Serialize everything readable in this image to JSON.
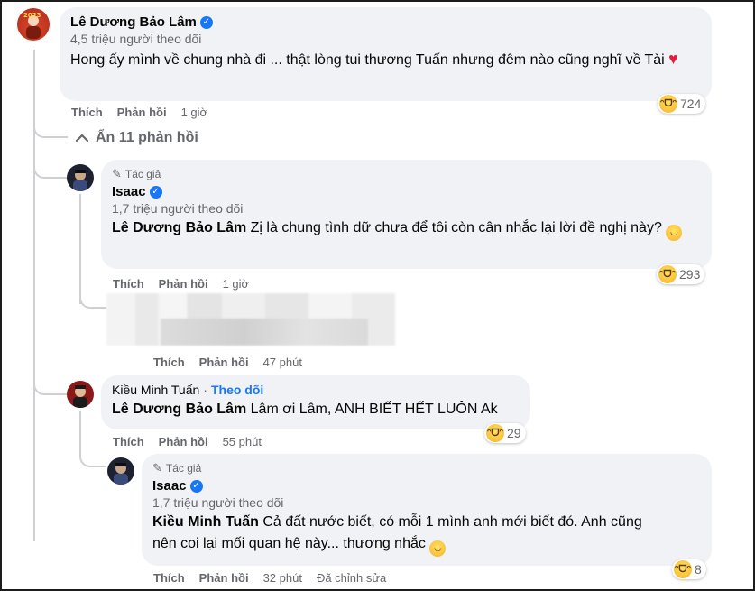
{
  "comment1": {
    "author": "Lê Dương Bảo Lâm",
    "followers": "4,5 triệu người theo dõi",
    "text": "Hong ấy mình về chung nhà đi ... thật lòng tui thương Tuấn nhưng đêm nào cũng nghĩ về Tài",
    "like_label": "Thích",
    "reply_label": "Phản hồi",
    "time": "1 giờ",
    "reaction_count": "724"
  },
  "toggle": {
    "label": "Ẩn 11 phản hồi"
  },
  "reply1": {
    "author_badge": "Tác giả",
    "author": "Isaac",
    "followers": "1,7 triệu người theo dõi",
    "mention": "Lê Dương Bảo Lâm",
    "text": "Zị là chung tình dữ chưa để tôi còn cân nhắc lại lời đề nghị này?",
    "like_label": "Thích",
    "reply_label": "Phản hồi",
    "time": "1 giờ",
    "reaction_count": "293"
  },
  "reply_blurred": {
    "like_label": "Thích",
    "reply_label": "Phản hồi",
    "time": "47 phút"
  },
  "reply2": {
    "author": "Kiều Minh Tuấn",
    "separator": "·",
    "follow_label": "Theo dõi",
    "mention": "Lê Dương Bảo Lâm",
    "text": "Lâm ơi Lâm, ANH BIẾT HẾT LUÔN Ak",
    "like_label": "Thích",
    "reply_label": "Phản hồi",
    "time": "55 phút",
    "reaction_count": "29"
  },
  "reply3": {
    "author_badge": "Tác giả",
    "author": "Isaac",
    "followers": "1,7 triệu người theo dõi",
    "mention": "Kiều Minh Tuấn",
    "text_line1": "Cả đất nước biết, có mỗi 1 mình anh mới biết đó. Anh cũng",
    "text_line2": "nên coi lại mối quan hệ này... thương nhắc",
    "like_label": "Thích",
    "reply_label": "Phản hồi",
    "time": "32 phút",
    "edited": "Đã chỉnh sửa",
    "reaction_count": "8"
  },
  "colors": {
    "bubble": "#f0f2f5",
    "secondary_text": "#65676b",
    "link": "#1877f2",
    "verified": "#1877f2"
  }
}
